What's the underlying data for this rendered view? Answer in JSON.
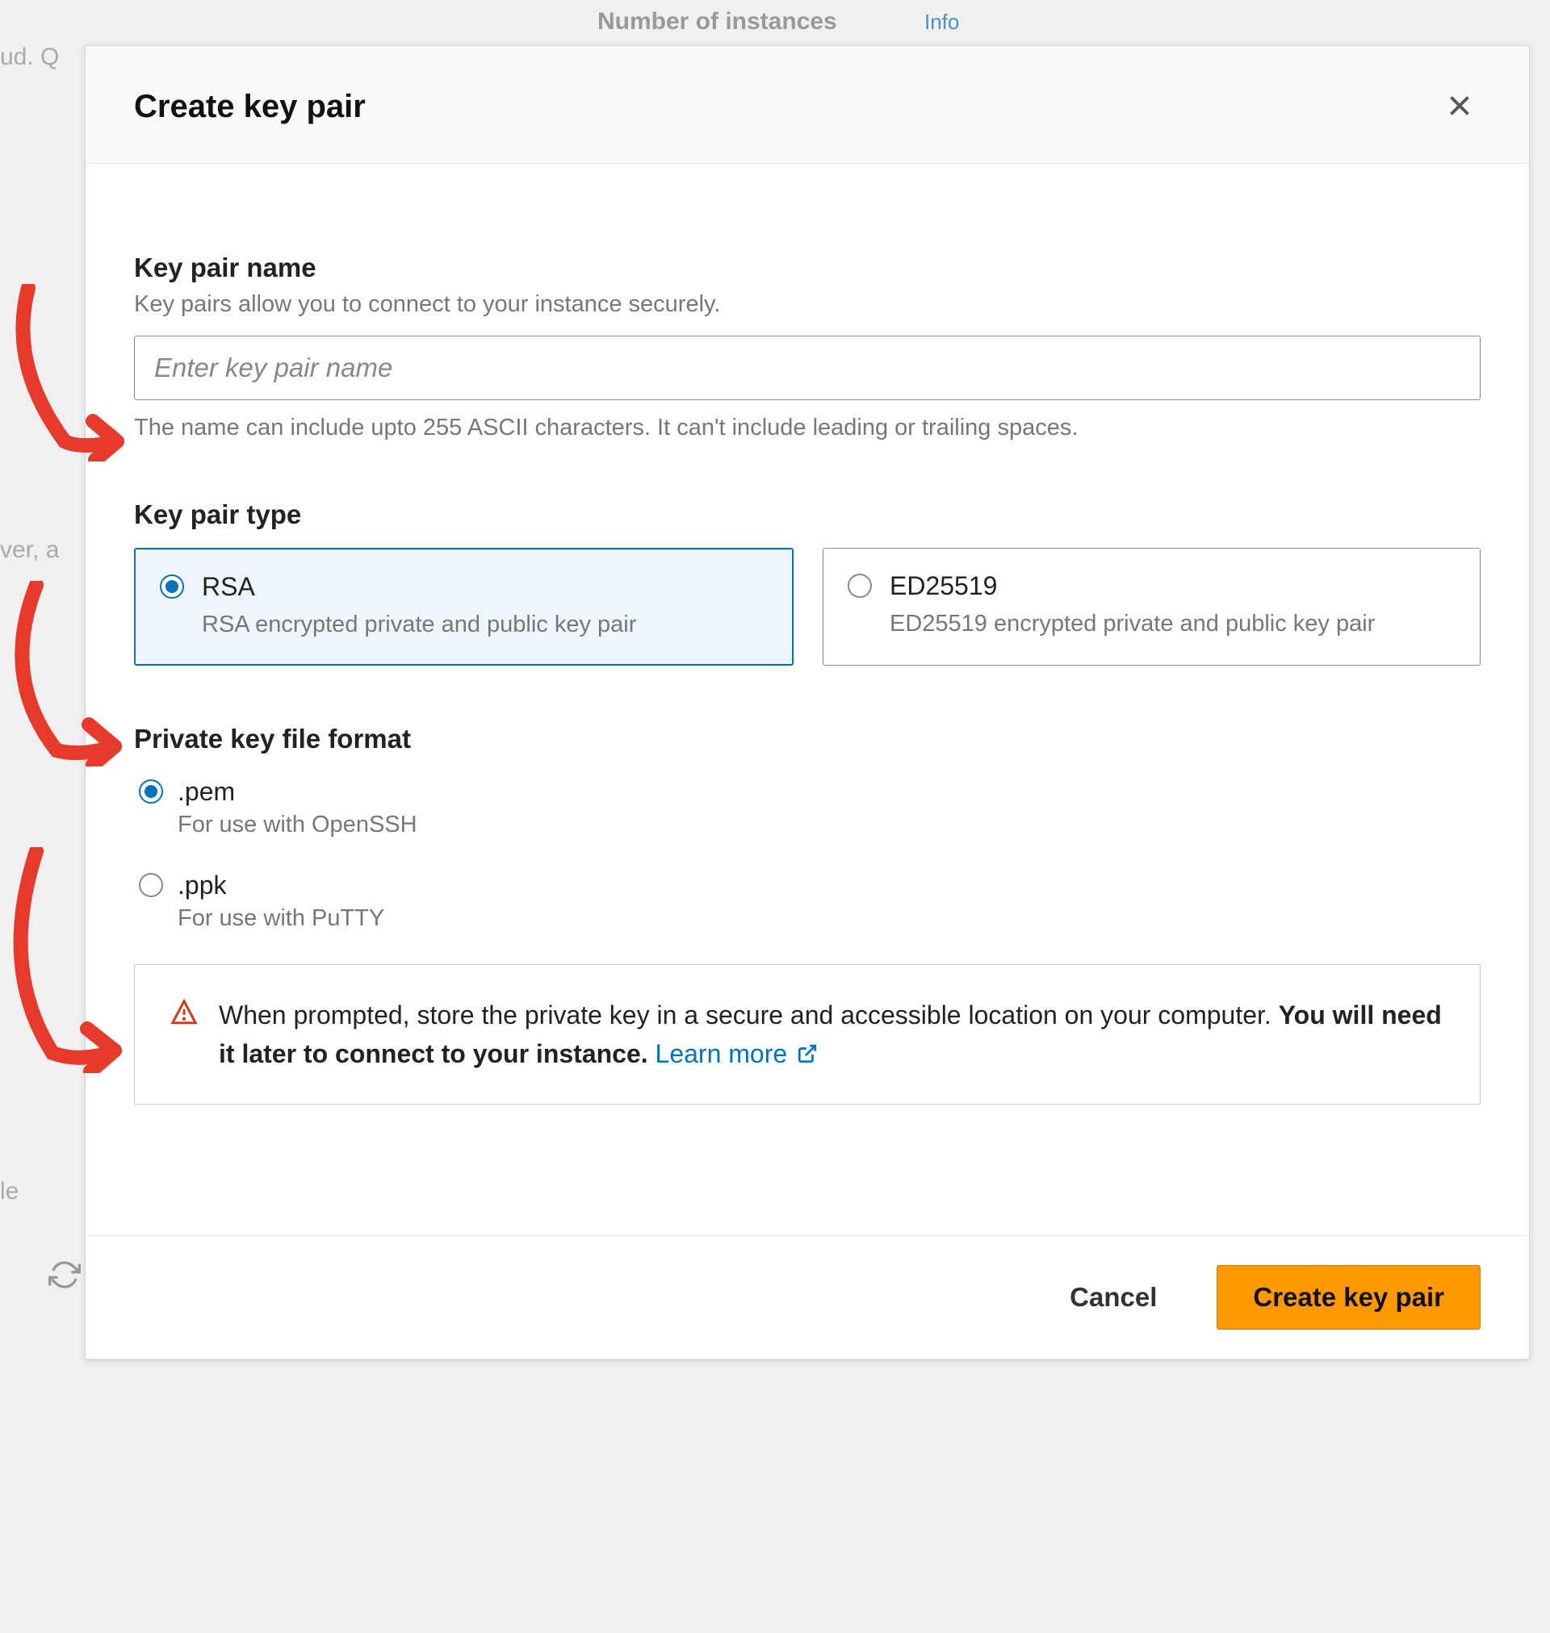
{
  "background": {
    "instances_label": "Number of instances",
    "info_link": "Info",
    "cloud_text": "ud. Q",
    "ver_text": "ver, a",
    "le_text": "le"
  },
  "modal": {
    "title": "Create key pair",
    "keypair_name": {
      "label": "Key pair name",
      "description": "Key pairs allow you to connect to your instance securely.",
      "placeholder": "Enter key pair name",
      "helper": "The name can include upto 255 ASCII characters. It can't include leading or trailing spaces."
    },
    "keypair_type": {
      "label": "Key pair type",
      "options": [
        {
          "title": "RSA",
          "description": "RSA encrypted private and public key pair",
          "selected": true
        },
        {
          "title": "ED25519",
          "description": "ED25519 encrypted private and public key pair",
          "selected": false
        }
      ]
    },
    "file_format": {
      "label": "Private key file format",
      "options": [
        {
          "title": ".pem",
          "description": "For use with OpenSSH",
          "selected": true
        },
        {
          "title": ".ppk",
          "description": "For use with PuTTY",
          "selected": false
        }
      ]
    },
    "alert": {
      "text1": "When prompted, store the private key in a secure and accessible location on your computer. ",
      "bold": "You will need it later to connect to your instance.",
      "link": "Learn more"
    },
    "footer": {
      "cancel": "Cancel",
      "submit": "Create key pair"
    }
  }
}
